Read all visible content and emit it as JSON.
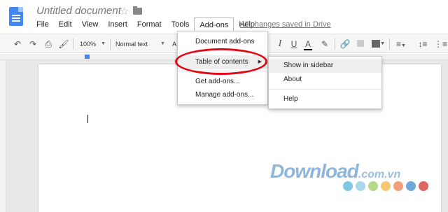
{
  "header": {
    "doc_title": "Untitled document",
    "saved_status": "All changes saved in Drive"
  },
  "menubar": {
    "items": [
      "File",
      "Edit",
      "View",
      "Insert",
      "Format",
      "Tools",
      "Add-ons",
      "Help"
    ],
    "open_menu": "Add-ons"
  },
  "toolbar": {
    "zoom": "100%",
    "style": "Normal text",
    "font_partial": "A"
  },
  "addons_menu": {
    "items": [
      {
        "label": "Document add-ons"
      },
      {
        "label": "Table of contents",
        "has_submenu": true,
        "highlighted": true
      },
      {
        "label": "Get add-ons..."
      },
      {
        "label": "Manage add-ons..."
      }
    ]
  },
  "submenu": {
    "items": [
      {
        "label": "Show in sidebar",
        "highlighted": true
      },
      {
        "label": "About"
      },
      {
        "label": "Help"
      }
    ]
  },
  "watermark": {
    "text": "Download",
    "suffix": ".com.vn",
    "dot_colors": [
      "#7ec8e3",
      "#a8d8ea",
      "#b5d98a",
      "#f7c873",
      "#f2a07b",
      "#6fa8dc",
      "#e06666"
    ]
  },
  "colors": {
    "accent_blue": "#4285f4",
    "highlight_red": "#e30613",
    "text_color_bar": "#000000"
  }
}
